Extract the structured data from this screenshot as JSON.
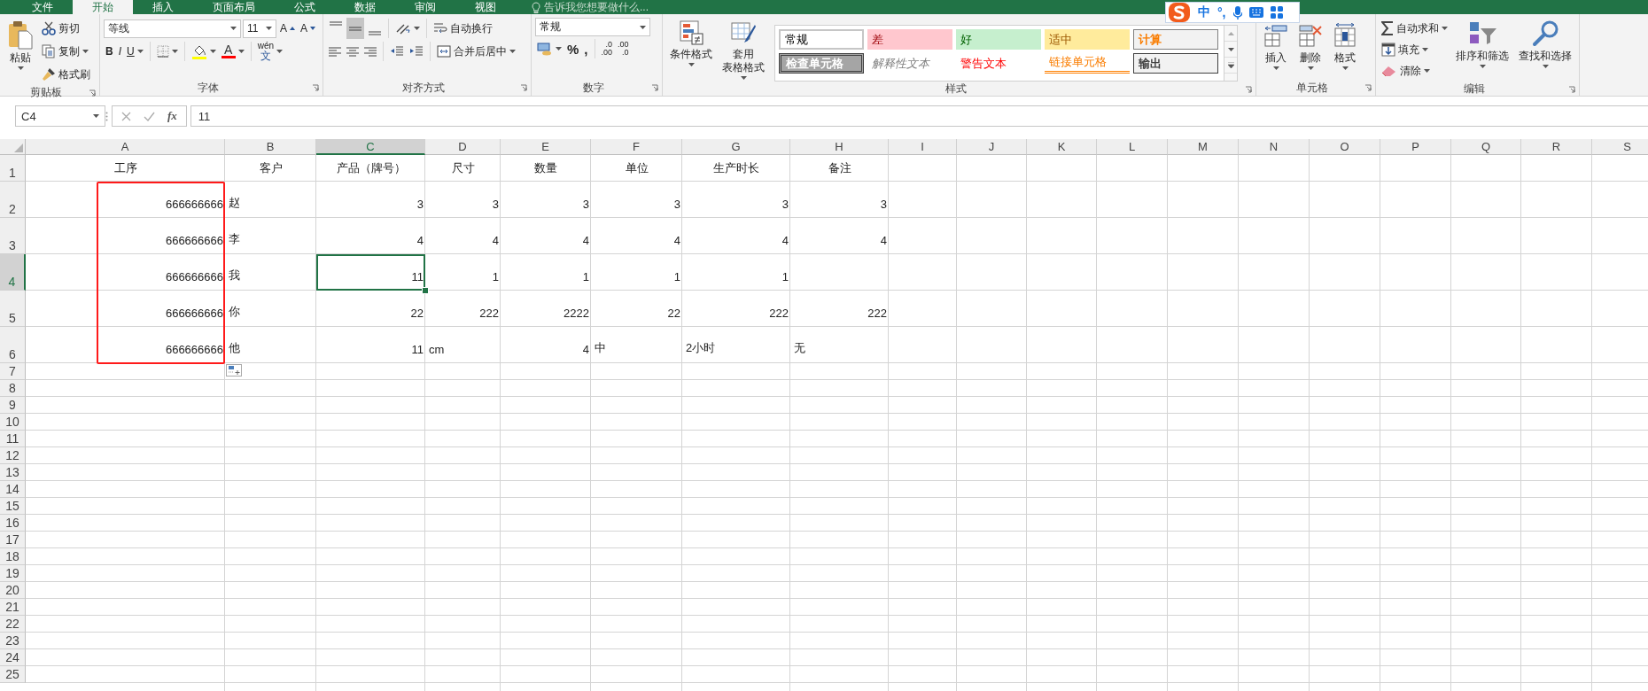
{
  "menu_tabs": [
    {
      "label": "文件",
      "selected": false
    },
    {
      "label": "开始",
      "selected": true
    },
    {
      "label": "插入",
      "selected": false
    },
    {
      "label": "页面布局",
      "selected": false
    },
    {
      "label": "公式",
      "selected": false
    },
    {
      "label": "数据",
      "selected": false
    },
    {
      "label": "审阅",
      "selected": false
    },
    {
      "label": "视图",
      "selected": false
    }
  ],
  "tell_me": {
    "placeholder": "告诉我您想要做什么..."
  },
  "ribbon": {
    "clipboard": {
      "label": "剪贴板",
      "paste": "粘贴",
      "cut": "剪切",
      "copy": "复制",
      "format_painter": "格式刷"
    },
    "font": {
      "label": "字体",
      "name": "等线",
      "size": "11",
      "grow": "A",
      "shrink": "A",
      "bold": "B",
      "italic": "I",
      "underline": "U",
      "font_color": "A",
      "phonetic_top": "wén",
      "phonetic_bottom": "文"
    },
    "alignment": {
      "label": "对齐方式",
      "vertical": [
        {
          "kind": "top",
          "selected": false
        },
        {
          "kind": "middle",
          "selected": true
        },
        {
          "kind": "bottom",
          "selected": false
        }
      ],
      "horizontal": [
        {
          "kind": "left",
          "selected": false
        },
        {
          "kind": "center",
          "selected": false
        },
        {
          "kind": "right",
          "selected": false
        }
      ],
      "wrap_text": "自动换行",
      "merge": "合并后居中"
    },
    "number": {
      "label": "数字",
      "format": "常规",
      "percent": "%",
      "comma": ",",
      "increase_decimal": [
        ".0",
        ".00"
      ],
      "decrease_decimal": [
        ".00",
        ".0"
      ]
    },
    "styles": {
      "label": "样式",
      "conditional": "条件格式",
      "table_format": [
        "套用",
        "表格格式"
      ],
      "gallery": [
        {
          "label": "常规",
          "kind": "normal"
        },
        {
          "label": "差",
          "kind": "bad"
        },
        {
          "label": "好",
          "kind": "good"
        },
        {
          "label": "适中",
          "kind": "neutral"
        },
        {
          "label": "计算",
          "kind": "calculation"
        },
        {
          "label": "检查单元格",
          "kind": "check"
        },
        {
          "label": "解释性文本",
          "kind": "explanatory"
        },
        {
          "label": "警告文本",
          "kind": "warning"
        },
        {
          "label": "链接单元格",
          "kind": "linked"
        },
        {
          "label": "输出",
          "kind": "output"
        }
      ]
    },
    "cells": {
      "label": "单元格",
      "insert": "插入",
      "delete": "删除",
      "format": "格式"
    },
    "editing": {
      "label": "编辑",
      "autosum": "自动求和",
      "fill": "填充",
      "clear": "清除",
      "sort": "排序和筛选",
      "find": "查找和选择"
    }
  },
  "ime_toolbar": {
    "mode": "中",
    "punctuation": "°,"
  },
  "formula_bar": {
    "name_box": "C4",
    "fx": "fx",
    "content": "11"
  },
  "sheet": {
    "columns": [
      {
        "label": "A",
        "selected": false
      },
      {
        "label": "B",
        "selected": false
      },
      {
        "label": "C",
        "selected": true
      },
      {
        "label": "D",
        "selected": false
      },
      {
        "label": "E",
        "selected": false
      },
      {
        "label": "F",
        "selected": false
      },
      {
        "label": "G",
        "selected": false
      },
      {
        "label": "H",
        "selected": false
      },
      {
        "label": "I",
        "selected": false
      },
      {
        "label": "J",
        "selected": false
      },
      {
        "label": "K",
        "selected": false
      },
      {
        "label": "L",
        "selected": false
      },
      {
        "label": "M",
        "selected": false
      },
      {
        "label": "N",
        "selected": false
      },
      {
        "label": "O",
        "selected": false
      },
      {
        "label": "P",
        "selected": false
      },
      {
        "label": "Q",
        "selected": false
      },
      {
        "label": "R",
        "selected": false
      },
      {
        "label": "S",
        "selected": false
      }
    ],
    "rows": [
      {
        "header": "1",
        "selected": false,
        "cells": [
          {
            "text": "工序",
            "kind": "heading",
            "selected": false
          },
          {
            "text": "客户",
            "kind": "heading",
            "selected": false
          },
          {
            "text": "产品（牌号）",
            "kind": "heading",
            "selected": false
          },
          {
            "text": "尺寸",
            "kind": "heading",
            "selected": false
          },
          {
            "text": "数量",
            "kind": "heading",
            "selected": false
          },
          {
            "text": "单位",
            "kind": "heading",
            "selected": false
          },
          {
            "text": "生产时长",
            "kind": "heading",
            "selected": false
          },
          {
            "text": "备注",
            "kind": "heading",
            "selected": false
          }
        ]
      },
      {
        "header": "2",
        "selected": false,
        "cells": [
          {
            "text": "666666666",
            "kind": "number",
            "selected": false
          },
          {
            "text": "赵",
            "kind": "text",
            "selected": false
          },
          {
            "text": "3",
            "kind": "number",
            "selected": false
          },
          {
            "text": "3",
            "kind": "number",
            "selected": false
          },
          {
            "text": "3",
            "kind": "number",
            "selected": false
          },
          {
            "text": "3",
            "kind": "number",
            "selected": false
          },
          {
            "text": "3",
            "kind": "number",
            "selected": false
          },
          {
            "text": "3",
            "kind": "number",
            "selected": false
          }
        ]
      },
      {
        "header": "3",
        "selected": false,
        "cells": [
          {
            "text": "666666666",
            "kind": "number",
            "selected": false
          },
          {
            "text": "李",
            "kind": "text",
            "selected": false
          },
          {
            "text": "4",
            "kind": "number",
            "selected": false
          },
          {
            "text": "4",
            "kind": "number",
            "selected": false
          },
          {
            "text": "4",
            "kind": "number",
            "selected": false
          },
          {
            "text": "4",
            "kind": "number",
            "selected": false
          },
          {
            "text": "4",
            "kind": "number",
            "selected": false
          },
          {
            "text": "4",
            "kind": "number",
            "selected": false
          }
        ]
      },
      {
        "header": "4",
        "selected": true,
        "cells": [
          {
            "text": "666666666",
            "kind": "number",
            "selected": false
          },
          {
            "text": "我",
            "kind": "text",
            "selected": false
          },
          {
            "text": "11",
            "kind": "number",
            "selected": true
          },
          {
            "text": "1",
            "kind": "number",
            "selected": false
          },
          {
            "text": "1",
            "kind": "number",
            "selected": false
          },
          {
            "text": "1",
            "kind": "number",
            "selected": false
          },
          {
            "text": "1",
            "kind": "number",
            "selected": false
          }
        ]
      },
      {
        "header": "5",
        "selected": false,
        "cells": [
          {
            "text": "666666666",
            "kind": "number",
            "selected": false
          },
          {
            "text": "你",
            "kind": "text",
            "selected": false
          },
          {
            "text": "22",
            "kind": "number",
            "selected": false
          },
          {
            "text": "222",
            "kind": "number",
            "selected": false
          },
          {
            "text": "2222",
            "kind": "number",
            "selected": false
          },
          {
            "text": "22",
            "kind": "number",
            "selected": false
          },
          {
            "text": "222",
            "kind": "number",
            "selected": false
          },
          {
            "text": "222",
            "kind": "number",
            "selected": false
          }
        ]
      },
      {
        "header": "6",
        "selected": false,
        "cells": [
          {
            "text": "666666666",
            "kind": "number",
            "selected": false
          },
          {
            "text": "他",
            "kind": "text",
            "selected": false
          },
          {
            "text": "11",
            "kind": "number",
            "selected": false
          },
          {
            "text": "cm",
            "kind": "text",
            "selected": false
          },
          {
            "text": "4",
            "kind": "number",
            "selected": false
          },
          {
            "text": "中",
            "kind": "text",
            "selected": false
          },
          {
            "text": "2小时",
            "kind": "text",
            "selected": false
          },
          {
            "text": "无",
            "kind": "text",
            "selected": false
          }
        ]
      },
      {
        "header": "7",
        "selected": false
      },
      {
        "header": "8",
        "selected": false
      },
      {
        "header": "9",
        "selected": false
      },
      {
        "header": "10",
        "selected": false
      },
      {
        "header": "11",
        "selected": false
      },
      {
        "header": "12",
        "selected": false
      },
      {
        "header": "13",
        "selected": false
      },
      {
        "header": "14",
        "selected": false
      },
      {
        "header": "15",
        "selected": false
      },
      {
        "header": "16",
        "selected": false
      },
      {
        "header": "17",
        "selected": false
      },
      {
        "header": "18",
        "selected": false
      },
      {
        "header": "19",
        "selected": false
      },
      {
        "header": "20",
        "selected": false
      },
      {
        "header": "21",
        "selected": false
      },
      {
        "header": "22",
        "selected": false
      },
      {
        "header": "23",
        "selected": false
      },
      {
        "header": "24",
        "selected": false
      },
      {
        "header": "25",
        "selected": false
      }
    ],
    "annotation": {
      "kind": "rectangle"
    }
  }
}
